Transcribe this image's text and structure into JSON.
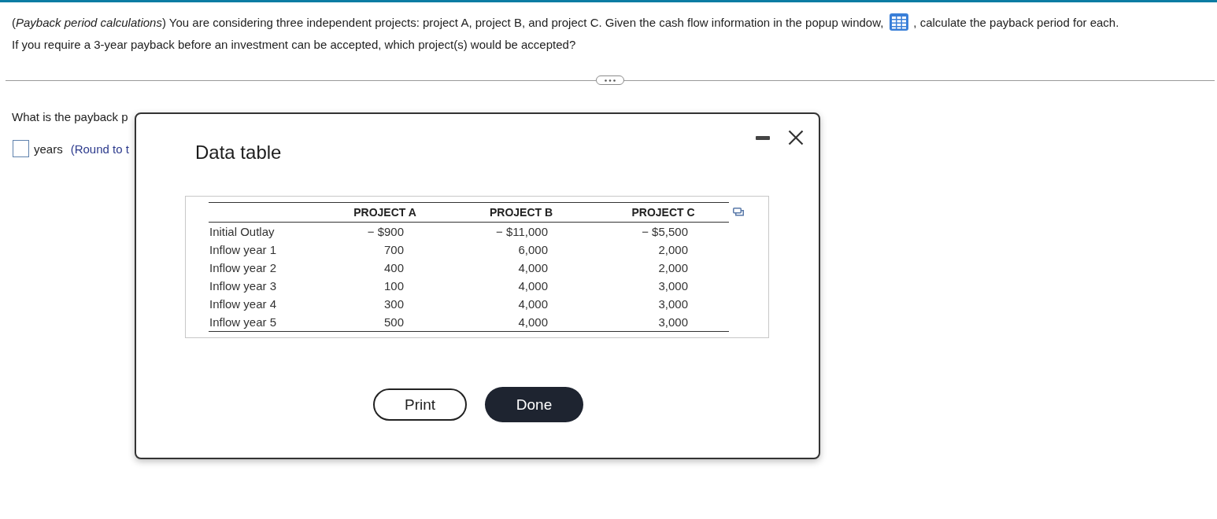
{
  "question": {
    "before_icon": "(*Payback period calculations*) You are considering three independent projects: project A, project B, and project C. Given the cash flow information in the popup window,",
    "after_icon": ", calculate the payback period for each.",
    "requirement": "If you require a 3-year payback before an investment can be accepted, which project(s) would be accepted?"
  },
  "answer": {
    "prompt": "What is the payback p",
    "unit": "years",
    "hint": "(Round to t"
  },
  "dialog": {
    "title": "Data table",
    "table": {
      "columns": [
        "PROJECT A",
        "PROJECT B",
        "PROJECT C"
      ],
      "rows": [
        {
          "label": "Initial Outlay",
          "values": [
            "− $900",
            "− $11,000",
            "− $5,500"
          ]
        },
        {
          "label": "Inflow year 1",
          "values": [
            "700",
            "6,000",
            "2,000"
          ]
        },
        {
          "label": "Inflow year 2",
          "values": [
            "400",
            "4,000",
            "2,000"
          ]
        },
        {
          "label": "Inflow year 3",
          "values": [
            "100",
            "4,000",
            "3,000"
          ]
        },
        {
          "label": "Inflow year 4",
          "values": [
            "300",
            "4,000",
            "3,000"
          ]
        },
        {
          "label": "Inflow year 5",
          "values": [
            "500",
            "4,000",
            "3,000"
          ]
        }
      ]
    },
    "buttons": [
      {
        "label": "Print",
        "kind": "secondary"
      },
      {
        "label": "Done",
        "kind": "primary"
      }
    ]
  }
}
